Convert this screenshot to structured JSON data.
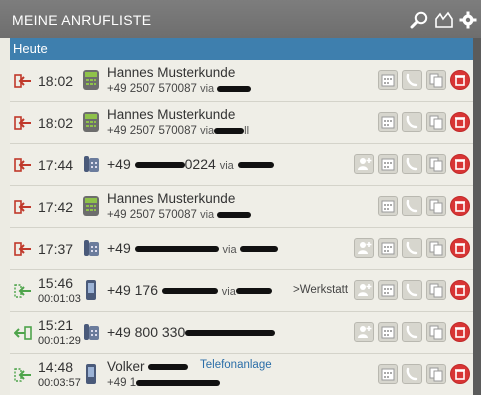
{
  "header": {
    "title": "MEINE ANRUFLISTE"
  },
  "section": {
    "label": "Heute"
  },
  "calls": [
    {
      "time": "18:02",
      "duration": "",
      "name": "Hannes Musterkunde",
      "number": "+49 2507 570087",
      "via": "via",
      "direction": "incoming",
      "device": "softphone",
      "target": "",
      "tag": ""
    },
    {
      "time": "18:02",
      "duration": "",
      "name": "Hannes Musterkunde",
      "number": "+49 2507 570087",
      "via": "via",
      "via_suffix": "ll",
      "direction": "incoming",
      "device": "softphone",
      "target": "",
      "tag": ""
    },
    {
      "time": "17:44",
      "duration": "",
      "name": "",
      "number": "+49",
      "number_suffix": "0224",
      "via": "via",
      "direction": "incoming",
      "device": "desk-phone",
      "target": "",
      "tag": ""
    },
    {
      "time": "17:42",
      "duration": "",
      "name": "Hannes Musterkunde",
      "number": "+49 2507 570087",
      "via": "via",
      "direction": "incoming",
      "device": "softphone",
      "target": "",
      "tag": ""
    },
    {
      "time": "17:37",
      "duration": "",
      "name": "",
      "number": "+49",
      "number_suffix": "",
      "via": "via",
      "direction": "incoming",
      "device": "desk-phone",
      "target": "",
      "tag": ""
    },
    {
      "time": "15:46",
      "duration": "00:01:03",
      "name": "",
      "number": "+49 176",
      "number_suffix": "",
      "via": "via",
      "direction": "forwarded",
      "device": "mobile",
      "target": ">Werkstatt",
      "tag": ""
    },
    {
      "time": "15:21",
      "duration": "00:01:29",
      "name": "",
      "number": "+49 800 330",
      "number_suffix": "",
      "via": "",
      "direction": "outgoing",
      "device": "desk-phone",
      "target": "",
      "tag": ""
    },
    {
      "time": "14:48",
      "duration": "00:03:57",
      "name": "Volker",
      "number": "+49 1",
      "number_suffix": "",
      "via": "",
      "direction": "forwarded",
      "device": "mobile",
      "target": "",
      "tag": "Telefonanlage"
    }
  ],
  "icons": {
    "search": "search-icon",
    "inbox": "inbox-icon",
    "settings": "gear-icon"
  },
  "colors": {
    "section_bg": "#3e7fae",
    "header_bg": "#767676",
    "incoming": "#c0392b",
    "outgoing": "#4ea44b",
    "softphone": "#8fc24a",
    "delete": "#d83535"
  }
}
